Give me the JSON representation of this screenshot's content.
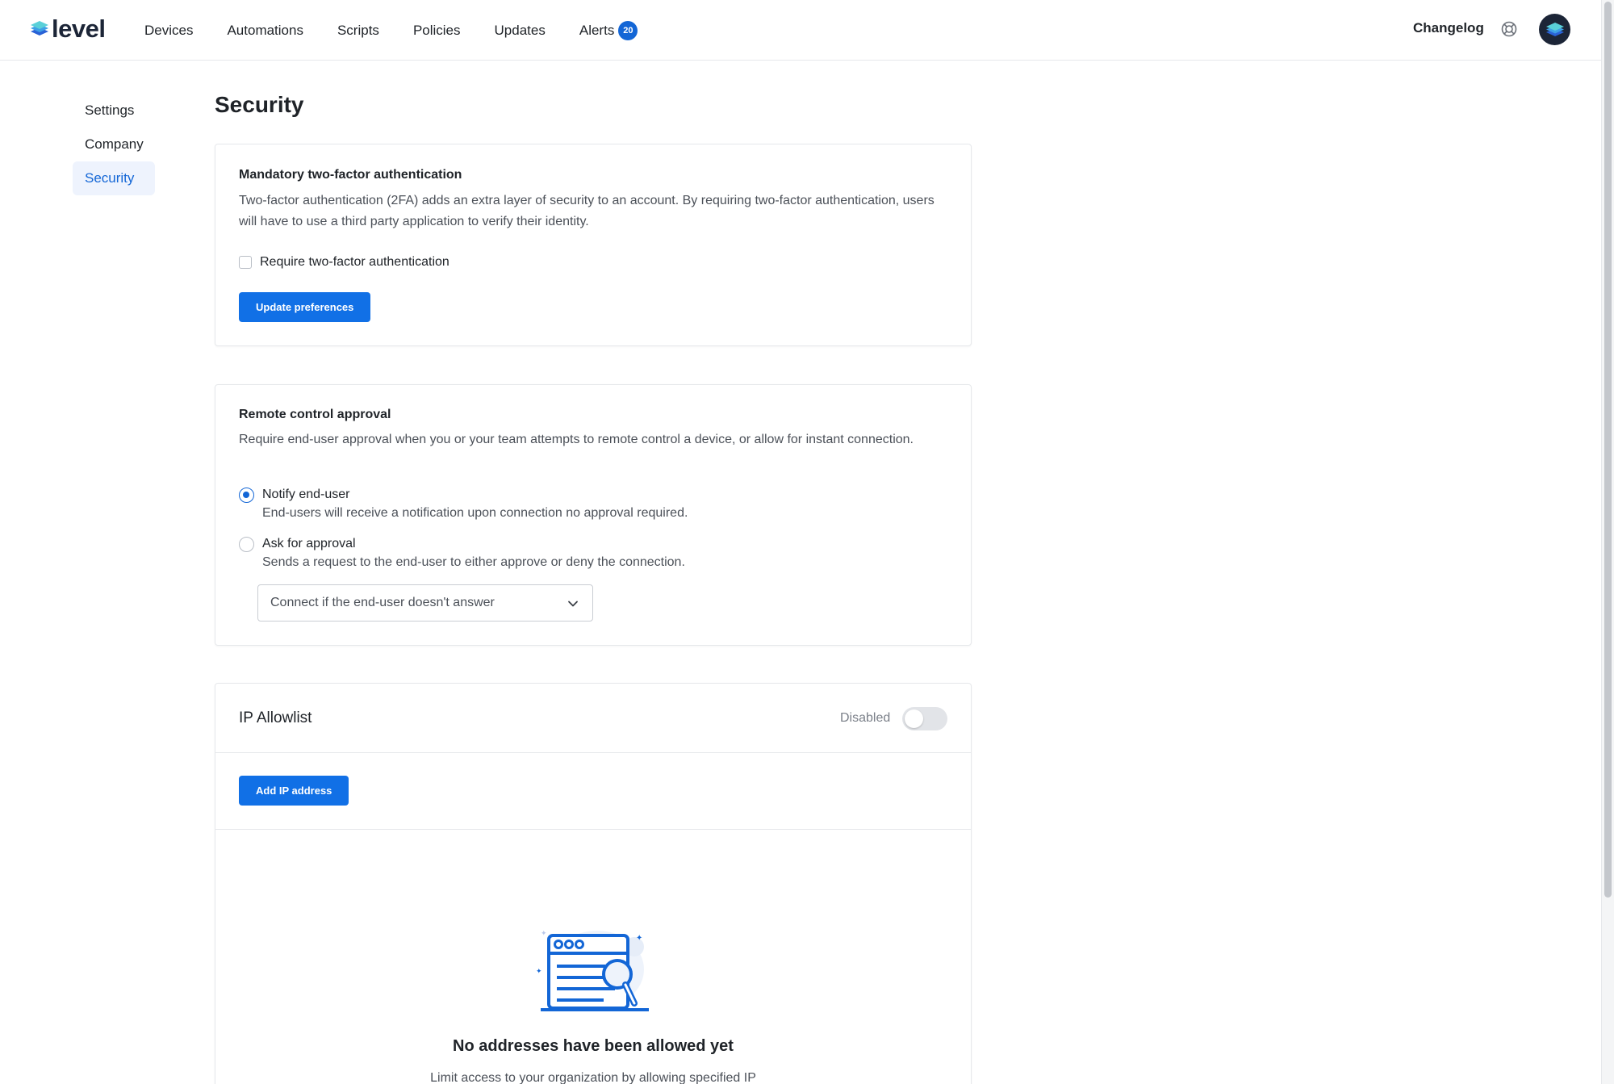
{
  "app": {
    "logo_text": "level"
  },
  "nav": {
    "items": [
      {
        "label": "Devices"
      },
      {
        "label": "Automations"
      },
      {
        "label": "Scripts"
      },
      {
        "label": "Policies"
      },
      {
        "label": "Updates"
      },
      {
        "label": "Alerts",
        "badge": "20"
      }
    ],
    "changelog": "Changelog"
  },
  "sidebar": {
    "items": [
      {
        "label": "Settings"
      },
      {
        "label": "Company"
      },
      {
        "label": "Security",
        "active": true
      }
    ]
  },
  "page": {
    "title": "Security"
  },
  "two_factor": {
    "title": "Mandatory two-factor authentication",
    "description": "Two-factor authentication (2FA) adds an extra layer of security to an account. By requiring two-factor authentication, users will have to use a third party application to verify their identity.",
    "checkbox_label": "Require two-factor authentication",
    "checkbox_checked": false,
    "button_label": "Update preferences"
  },
  "remote_control": {
    "title": "Remote control approval",
    "description": "Require end-user approval when you or your team attempts to remote control a device, or allow for instant connection.",
    "options": [
      {
        "label": "Notify end-user",
        "sub": "End-users will receive a notification upon connection no approval required.",
        "checked": true
      },
      {
        "label": "Ask for approval",
        "sub": "Sends a request to the end-user to either approve or deny the connection.",
        "checked": false
      }
    ],
    "select_value": "Connect if the end-user doesn't answer"
  },
  "ip_allowlist": {
    "title": "IP Allowlist",
    "toggle_label": "Disabled",
    "toggle_on": false,
    "button_label": "Add IP address",
    "empty_title": "No addresses have been allowed yet",
    "empty_desc": "Limit access to your organization by allowing specified IP"
  },
  "colors": {
    "primary": "#1170e6",
    "active_bg": "#eef3fd",
    "active_text": "#1366d6",
    "badge": "#1366d6",
    "border": "#e6e8eb"
  },
  "icons": {
    "logo": "level-layers-logo-icon",
    "help": "lifebuoy-icon",
    "avatar": "layers-avatar-icon",
    "select": "chevron-down-icon",
    "empty": "browser-search-illustration"
  }
}
